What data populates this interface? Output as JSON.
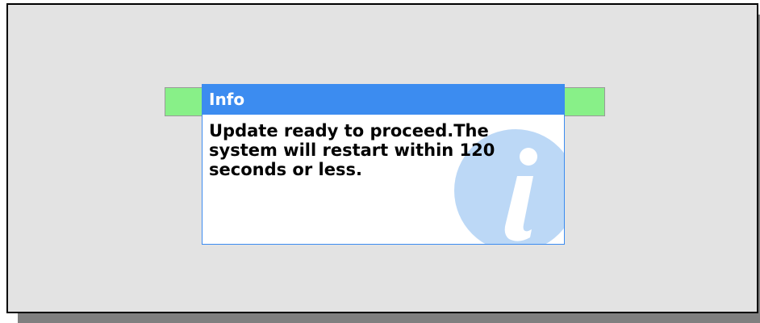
{
  "progress": {
    "value_fraction": 1.0,
    "fill_color": "#88f088"
  },
  "dialog": {
    "title": "Info",
    "message": "Update ready to proceed.The system will restart within 120 seconds or less.",
    "icon": "info-icon",
    "accent_color": "#3c8cf0",
    "icon_color": "#bcd8f6"
  }
}
